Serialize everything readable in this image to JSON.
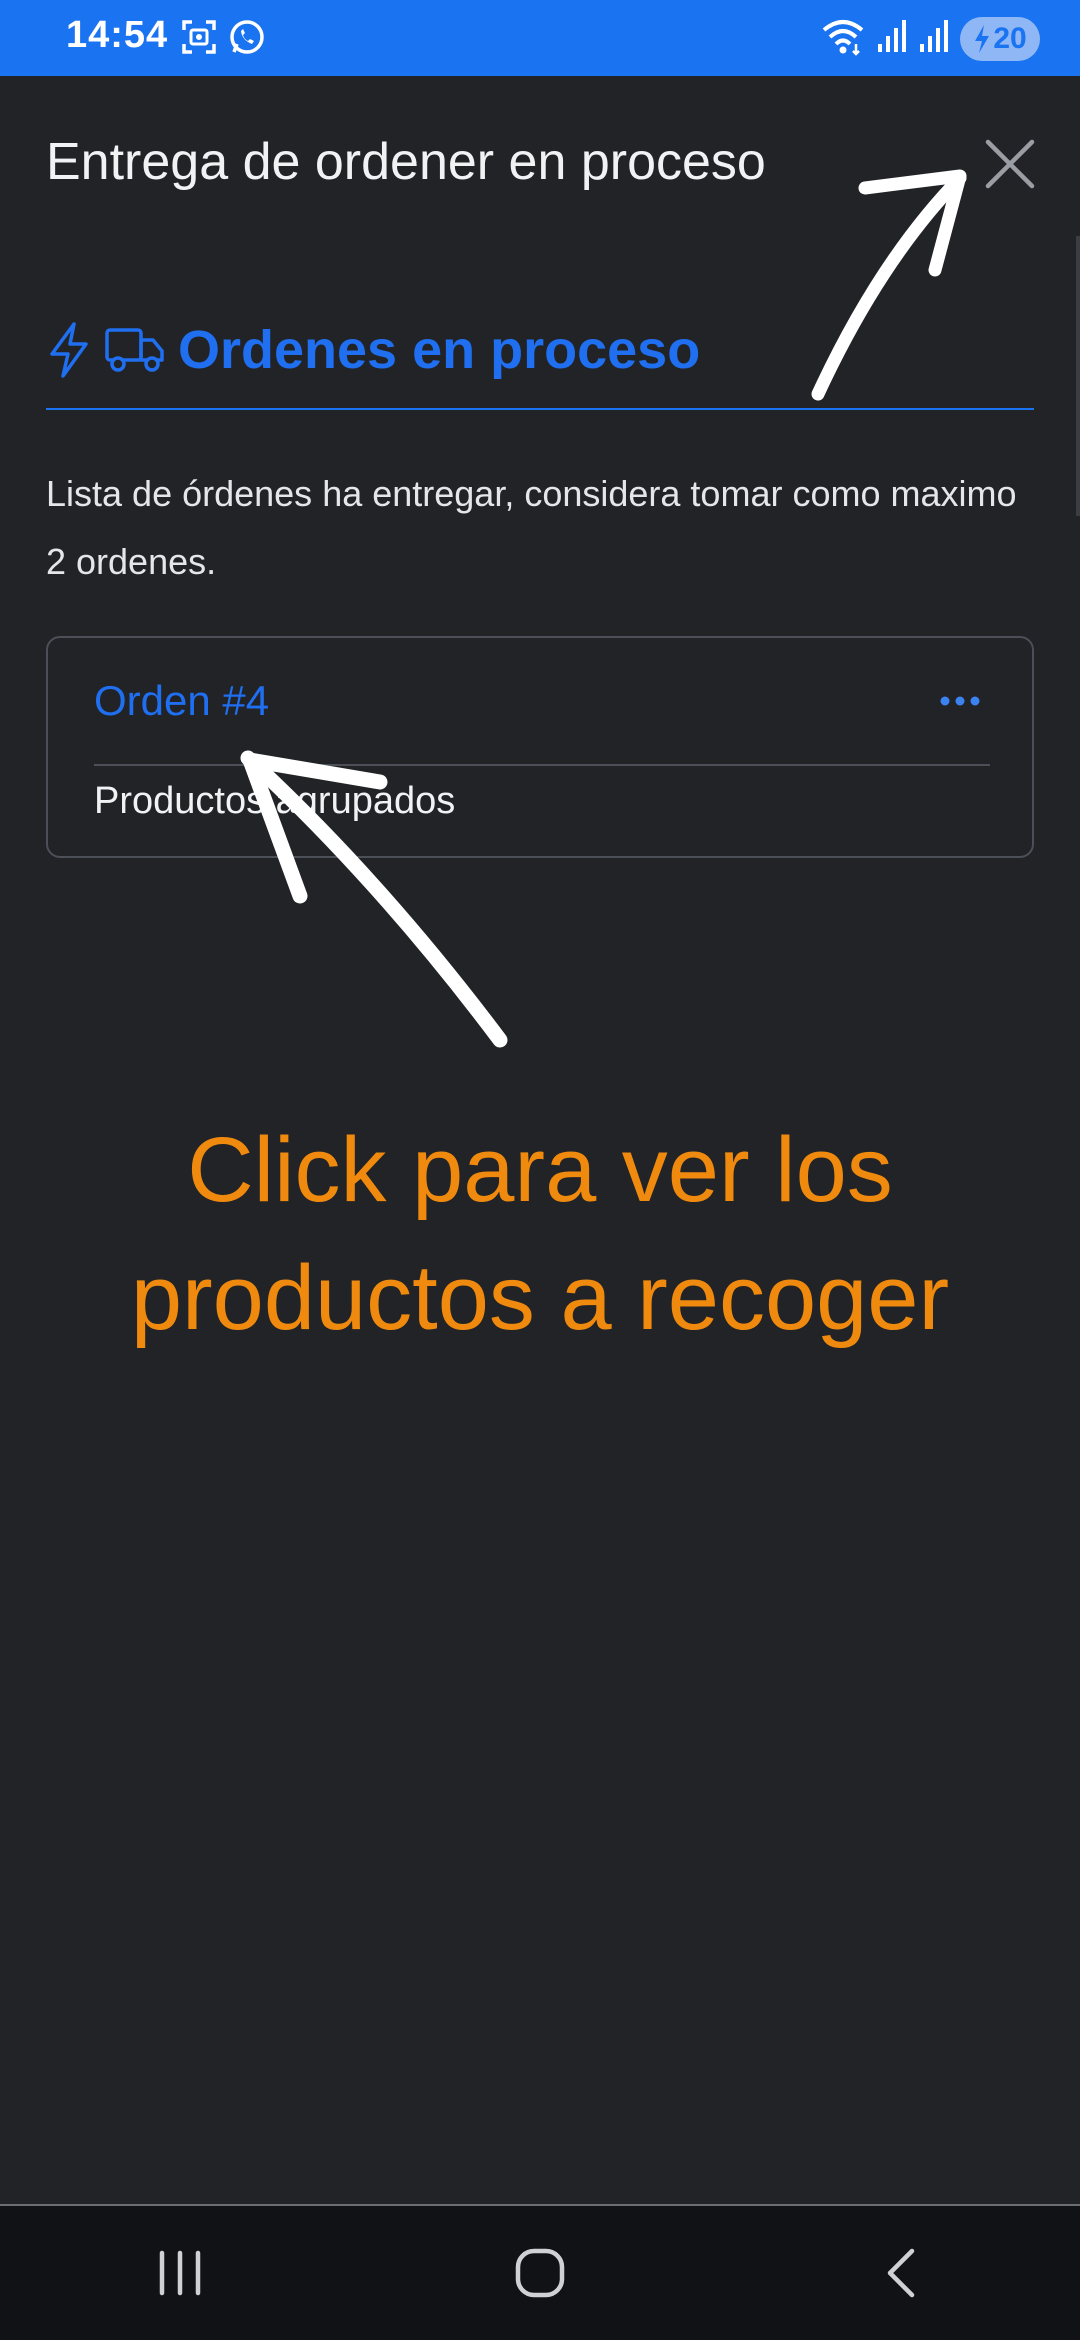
{
  "status_bar": {
    "time": "14:54",
    "battery_level": "20",
    "icons": [
      "screenshot-icon",
      "whatsapp-icon",
      "wifi-icon",
      "signal-icon",
      "signal-icon",
      "battery-charging-icon"
    ]
  },
  "modal": {
    "title": "Entrega de ordener en proceso",
    "close_icon": "close-icon"
  },
  "tab": {
    "label": "Ordenes en proceso",
    "icons": [
      "lightning-icon",
      "truck-icon"
    ]
  },
  "description": "Lista de órdenes ha entregar, considera tomar como maximo 2 ordenes.",
  "orders": [
    {
      "title": "Orden #4",
      "subtitle": "Productos agrupados",
      "menu_icon": "more-horizontal-icon"
    }
  ],
  "annotation": {
    "line1": "Click para ver los",
    "line2": "productos a recoger"
  },
  "nav_bar": {
    "icons": [
      "recent-apps-icon",
      "home-icon",
      "back-icon"
    ]
  },
  "colors": {
    "status_bar": "#1a73f0",
    "background": "#212327",
    "accent": "#1f6ff0",
    "annotation": "#f08a0e",
    "nav_bar": "#111215"
  }
}
